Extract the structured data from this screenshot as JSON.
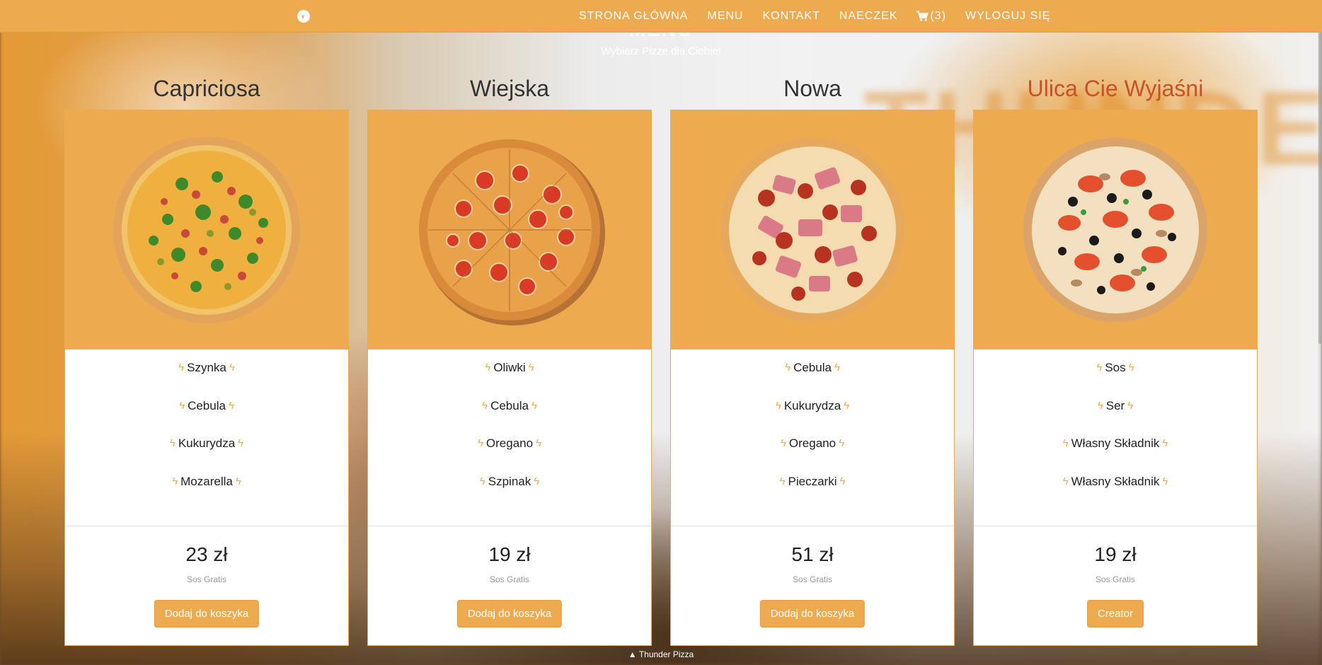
{
  "navbar": {
    "brand_icon": "pizza-logo-icon",
    "links": {
      "home": "STRONA GŁÓWNA",
      "menu": "MENU",
      "contact": "KONTAKT",
      "naeczek": "NAECZEK",
      "cart_count": "(3)",
      "logout": "WYLOGUJ SIĘ"
    },
    "cart_icon": "shopping-cart-icon"
  },
  "hero": {
    "title": "MENU",
    "subtitle": "Wybierz Pizze dla Ciebie!"
  },
  "colors": {
    "accent": "#eeaa4f",
    "custom_title": "#c8502a"
  },
  "cards": [
    {
      "title": "Capriciosa",
      "ingredients": [
        "Szynka",
        "Cebula",
        "Kukurydza",
        "Mozarella"
      ],
      "price": "23 zł",
      "note": "Sos Gratis",
      "button": "Dodaj do koszyka"
    },
    {
      "title": "Wiejska",
      "ingredients": [
        "Oliwki",
        "Cebula",
        "Oregano",
        "Szpinak"
      ],
      "price": "19 zł",
      "note": "Sos Gratis",
      "button": "Dodaj do koszyka"
    },
    {
      "title": "Nowa",
      "ingredients": [
        "Cebula",
        "Kukurydza",
        "Oregano",
        "Pieczarki"
      ],
      "price": "51 zł",
      "note": "Sos Gratis",
      "button": "Dodaj do koszyka"
    },
    {
      "title": "Ulica Cie Wyjaśni",
      "ingredients": [
        "Sos",
        "Ser",
        "Własny Składnik",
        "Własny Składnik"
      ],
      "price": "19 zł",
      "note": "Sos Gratis",
      "button": "Creator"
    }
  ],
  "footer": {
    "icon": "chevron-up-icon",
    "text": "Thunder Pizza"
  }
}
